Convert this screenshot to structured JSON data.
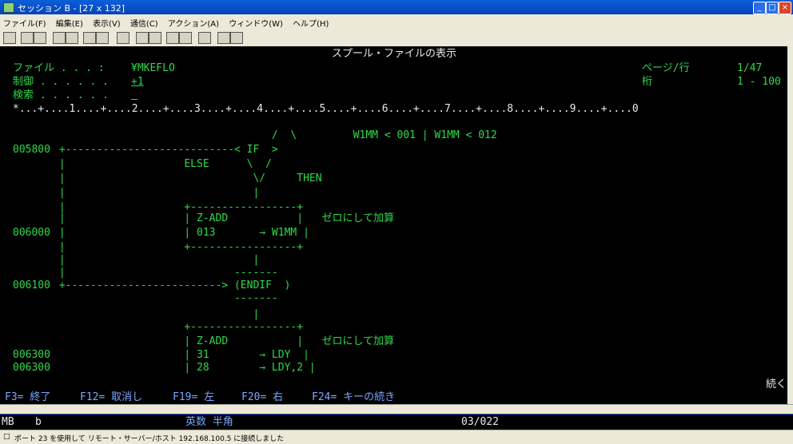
{
  "window": {
    "title": "セッション B - [27 x 132]"
  },
  "menu": [
    "ファイル(F)",
    "編集(E)",
    "表示(V)",
    "通信(C)",
    "アクション(A)",
    "ウィンドウ(W)",
    "ヘルプ(H)"
  ],
  "screen": {
    "title": "スプール・ファイルの表示",
    "file_label": "ファイル . . . :",
    "file_value": "¥MKEFLO",
    "control_label": "制御 . . . . . .",
    "control_value": "+1",
    "search_label": "検索 . . . . . .",
    "page_label": "ページ/行",
    "page_value": "1/47",
    "column_label": "桁",
    "column_value": "1 - 100",
    "ruler": "*...+....1....+....2....+....3....+....4....+....5....+....6....+....7....+....8....+....9....+....0"
  },
  "listing": [
    {
      "seq": "",
      "text": "                                   /  \\         W1MM < 001 | W1MM < 012"
    },
    {
      "seq": "005800",
      "text": " +---------------------------< IF  >"
    },
    {
      "seq": "",
      "text": " |                   ELSE      \\  /"
    },
    {
      "seq": "",
      "text": " |                              \\/     THEN"
    },
    {
      "seq": "",
      "text": " |                              |"
    },
    {
      "seq": "",
      "text": " |                   +-----------------+"
    },
    {
      "seq": "",
      "text": " |                   | Z-ADD           |   ゼロにして加算"
    },
    {
      "seq": "006000",
      "text": " |                   | 013       → W1MM |"
    },
    {
      "seq": "",
      "text": " |                   +-----------------+"
    },
    {
      "seq": "",
      "text": " |                              |"
    },
    {
      "seq": "",
      "text": " |                           -------"
    },
    {
      "seq": "006100",
      "text": " +-------------------------> (ENDIF  )"
    },
    {
      "seq": "",
      "text": "                             -------"
    },
    {
      "seq": "",
      "text": "                                |"
    },
    {
      "seq": "",
      "text": "                     +-----------------+"
    },
    {
      "seq": "",
      "text": "                     | Z-ADD           |   ゼロにして加算"
    },
    {
      "seq": "006300",
      "text": "                     | 31        → LDY  |"
    },
    {
      "seq": "006300",
      "text": "                     | 28        → LDY,2 |"
    }
  ],
  "more": "続く",
  "function_keys": [
    {
      "key": "F3=",
      "label": "終了"
    },
    {
      "key": "F12=",
      "label": "取消し"
    },
    {
      "key": "F19=",
      "label": "左"
    },
    {
      "key": "F20=",
      "label": "右"
    },
    {
      "key": "F24=",
      "label": "キーの続き"
    }
  ],
  "oia": {
    "mode": "MB",
    "field": "b",
    "input_mode": "英数 半角",
    "cursor": "03/022"
  },
  "status": "ポート 23 を使用して リモート・サーバー/ホスト 192.168.100.5 に接続しました"
}
